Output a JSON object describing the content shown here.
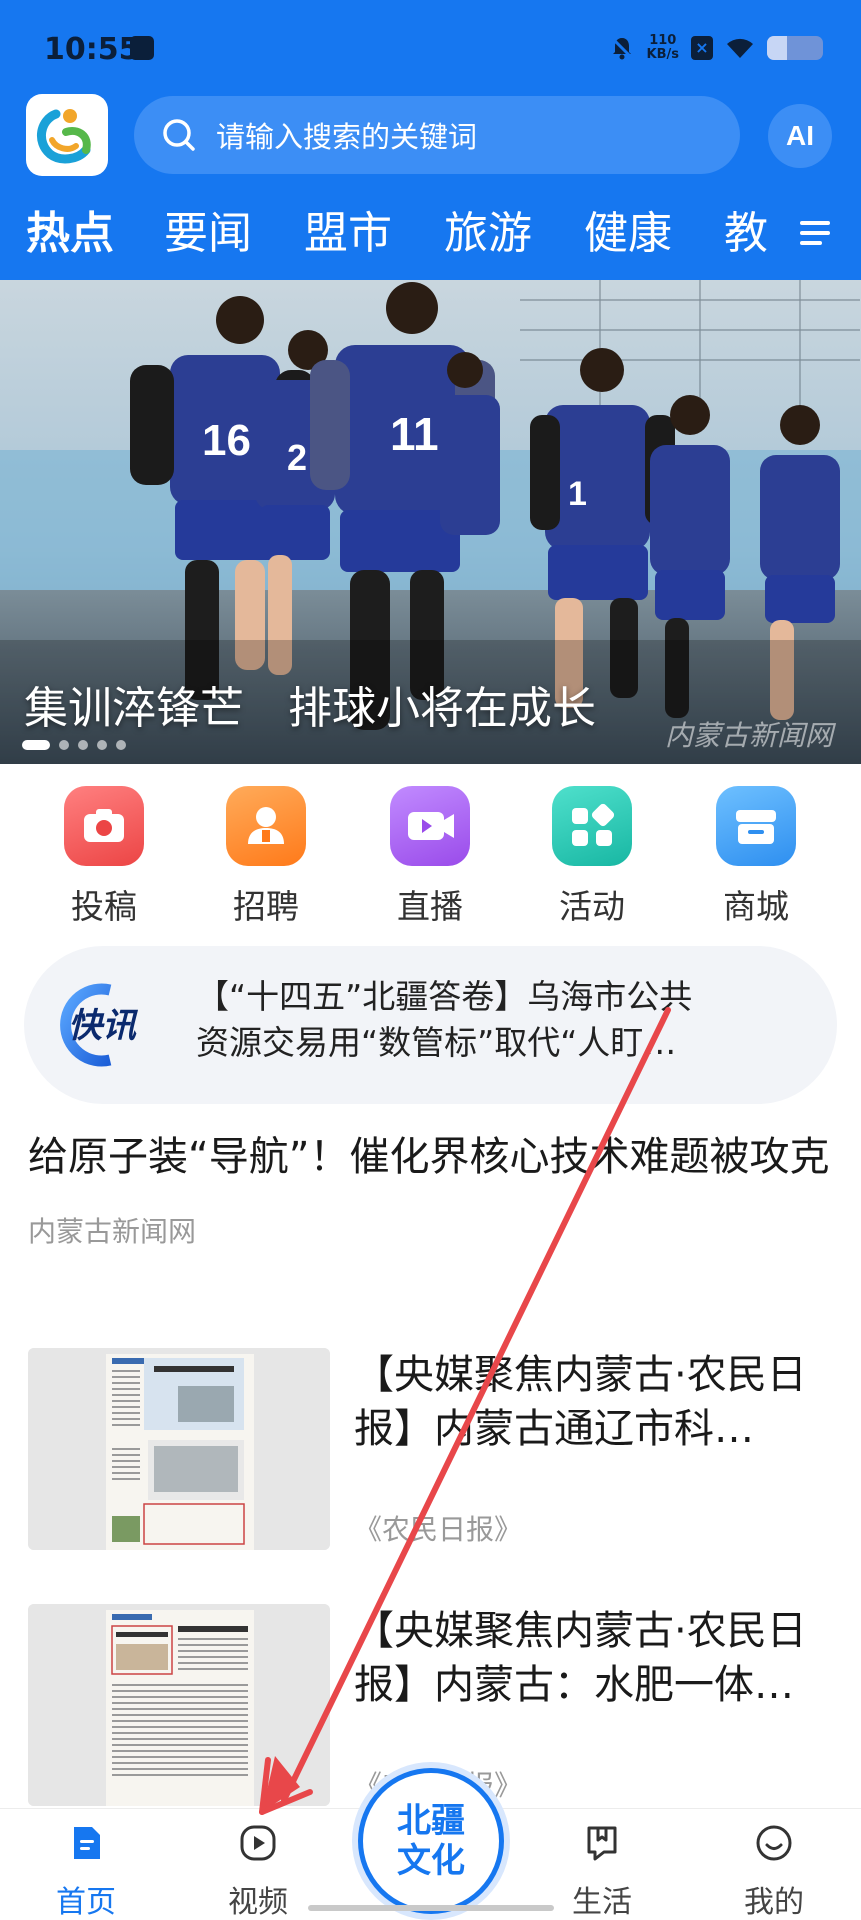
{
  "status_bar": {
    "time": "10:55",
    "net_speed_value": "110",
    "net_speed_unit": "KB/s",
    "battery_level": 0.35
  },
  "search": {
    "placeholder": "请输入搜索的关键词",
    "ai_label": "AI"
  },
  "tabs": [
    {
      "label": "热点",
      "active": true
    },
    {
      "label": "要闻",
      "active": false
    },
    {
      "label": "盟市",
      "active": false
    },
    {
      "label": "旅游",
      "active": false
    },
    {
      "label": "健康",
      "active": false
    },
    {
      "label": "教",
      "active": false
    }
  ],
  "banner": {
    "caption": "集训淬锋芒　排球小将在成长",
    "watermark": "内蒙古新闻网",
    "slide_count": 5,
    "active_slide": 1,
    "jersey_numbers": [
      "16",
      "2",
      "11",
      "1"
    ]
  },
  "quick_actions": [
    {
      "label": "投稿",
      "icon": "camera-icon",
      "color": "#f25b5b"
    },
    {
      "label": "招聘",
      "icon": "person-icon",
      "color": "#ff8a2a"
    },
    {
      "label": "直播",
      "icon": "video-icon",
      "color": "#a85bf0"
    },
    {
      "label": "活动",
      "icon": "grid-icon",
      "color": "#25c7b4"
    },
    {
      "label": "商城",
      "icon": "store-icon",
      "color": "#3aa0f5"
    }
  ],
  "flash_news": {
    "badge": "快讯",
    "line1": "【“十四五”北疆答卷】乌海市公共",
    "line2": "资源交易用“数管标”取代“人盯…"
  },
  "feed": {
    "article1": {
      "title": "给原子装“导航”！催化界核心技术难题被攻克",
      "source": "内蒙古新闻网"
    },
    "cards": [
      {
        "title": "【央媒聚焦内蒙古·农民日报】内蒙古通辽市科…",
        "source": "《农民日报》"
      },
      {
        "title": "【央媒聚焦内蒙古·农民日报】内蒙古：水肥一体…",
        "source": "《农民日报》"
      }
    ]
  },
  "bottom_nav": {
    "items": [
      {
        "label": "首页",
        "icon": "home-doc-icon",
        "active": true
      },
      {
        "label": "视频",
        "icon": "play-icon",
        "active": false
      },
      {
        "label": "生活",
        "icon": "bookmark-chat-icon",
        "active": false
      },
      {
        "label": "我的",
        "icon": "smile-icon",
        "active": false
      }
    ],
    "center_badge": "北疆文化"
  },
  "colors": {
    "brand_blue": "#1677f0",
    "annotation_red": "#e8474a"
  }
}
